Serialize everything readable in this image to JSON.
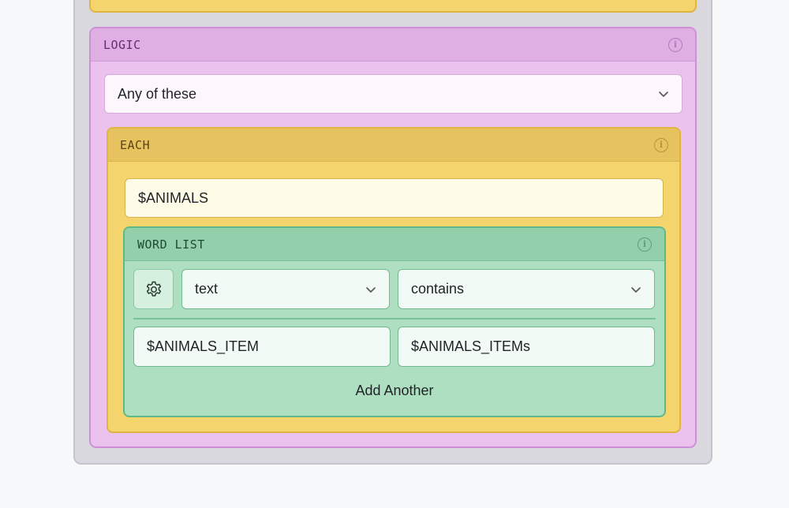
{
  "logic": {
    "title": "LOGIC",
    "mode_select": "Any of these",
    "each": {
      "title": "EACH",
      "variable": "$ANIMALS",
      "word_list": {
        "title": "WORD LIST",
        "field_select": "text",
        "operator_select": "contains",
        "value_1": "$ANIMALS_ITEM",
        "value_2": "$ANIMALS_ITEMs",
        "add_label": "Add Another"
      }
    }
  },
  "icons": {
    "info": "info-icon",
    "chevron": "chevron-down-icon",
    "settings": "gear-icon"
  },
  "colors": {
    "logic_bg": "#ebc1ee",
    "each_bg": "#f4d46c",
    "wordlist_bg": "#aedfc1"
  }
}
